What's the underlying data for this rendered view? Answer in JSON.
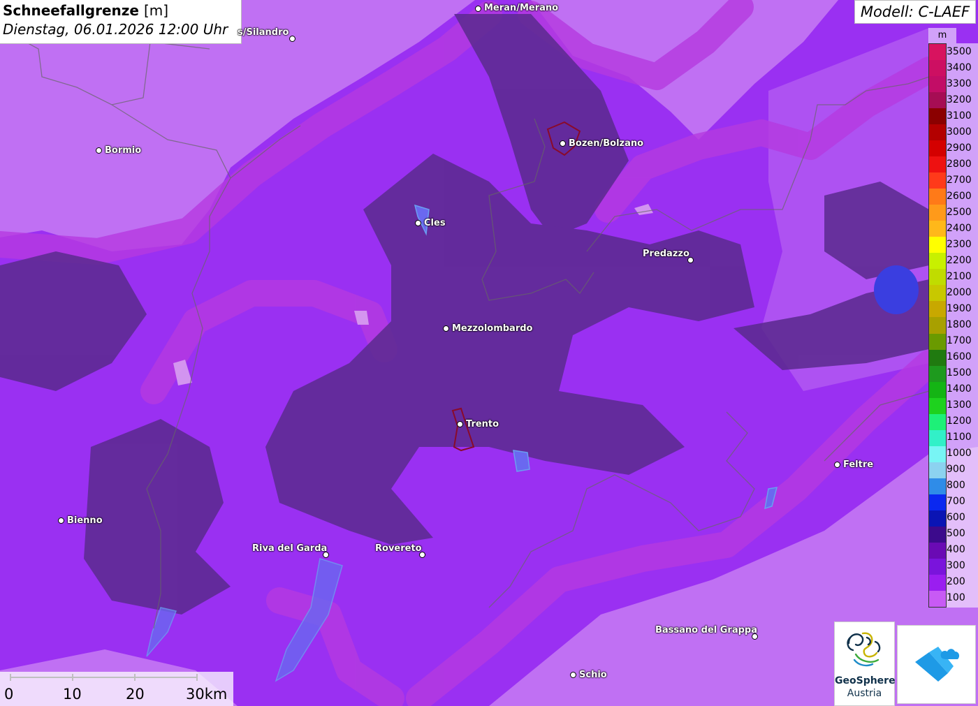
{
  "title": {
    "main": "Schneefallgrenze",
    "unit": "[m]",
    "datetime": "Dienstag, 06.01.2026 12:00 Uhr"
  },
  "model": "Modell: C-LAEF",
  "legend": {
    "unit": "m",
    "items": [
      {
        "label": "3500",
        "color": "#d8135f"
      },
      {
        "label": "3400",
        "color": "#cd0f62"
      },
      {
        "label": "3300",
        "color": "#c20d66"
      },
      {
        "label": "3200",
        "color": "#a60d54"
      },
      {
        "label": "3100",
        "color": "#8b0000"
      },
      {
        "label": "3000",
        "color": "#b30000"
      },
      {
        "label": "2900",
        "color": "#d40000"
      },
      {
        "label": "2800",
        "color": "#ee1111"
      },
      {
        "label": "2700",
        "color": "#ff3a1a"
      },
      {
        "label": "2600",
        "color": "#ff7a18"
      },
      {
        "label": "2500",
        "color": "#ff9a1a"
      },
      {
        "label": "2400",
        "color": "#ffb81a"
      },
      {
        "label": "2300",
        "color": "#ffff00"
      },
      {
        "label": "2200",
        "color": "#c8f000"
      },
      {
        "label": "2100",
        "color": "#c0dc00"
      },
      {
        "label": "2000",
        "color": "#c8c800"
      },
      {
        "label": "1900",
        "color": "#c8a800"
      },
      {
        "label": "1800",
        "color": "#a8a000"
      },
      {
        "label": "1700",
        "color": "#6a9a00"
      },
      {
        "label": "1600",
        "color": "#207a10"
      },
      {
        "label": "1500",
        "color": "#1e9a1e"
      },
      {
        "label": "1400",
        "color": "#14b414"
      },
      {
        "label": "1300",
        "color": "#1ed21e"
      },
      {
        "label": "1200",
        "color": "#1ef078"
      },
      {
        "label": "1100",
        "color": "#32f0c8"
      },
      {
        "label": "1000",
        "color": "#78f5f5"
      },
      {
        "label": "900",
        "color": "#8cd2f0"
      },
      {
        "label": "800",
        "color": "#2f8ce8"
      },
      {
        "label": "700",
        "color": "#0a28f0"
      },
      {
        "label": "600",
        "color": "#0a14b4"
      },
      {
        "label": "500",
        "color": "#3c0a8c"
      },
      {
        "label": "400",
        "color": "#6a0ab4"
      },
      {
        "label": "300",
        "color": "#7a14dc"
      },
      {
        "label": "200",
        "color": "#9a1ef0"
      },
      {
        "label": "100",
        "color": "#c85af5"
      }
    ]
  },
  "cities": [
    {
      "id": "meran",
      "name": "Meran/Merano"
    },
    {
      "id": "silandro",
      "name": "s/Silandro"
    },
    {
      "id": "bormio",
      "name": "Bormio"
    },
    {
      "id": "bozen",
      "name": "Bozen/Bolzano"
    },
    {
      "id": "cles",
      "name": "Cles"
    },
    {
      "id": "predazzo",
      "name": "Predazzo"
    },
    {
      "id": "mezzolombardo",
      "name": "Mezzolombardo"
    },
    {
      "id": "trento",
      "name": "Trento"
    },
    {
      "id": "feltre",
      "name": "Feltre"
    },
    {
      "id": "bienno",
      "name": "Bienno"
    },
    {
      "id": "riva",
      "name": "Riva del Garda"
    },
    {
      "id": "rovereto",
      "name": "Rovereto"
    },
    {
      "id": "bassano",
      "name": "Bassano del Grappa"
    },
    {
      "id": "schio",
      "name": "Schio"
    }
  ],
  "scalebar": {
    "labels": [
      "0",
      "10",
      "20",
      "30km"
    ]
  },
  "logos": {
    "geosphere_name": "GeoSphere",
    "geosphere_sub": "Austria"
  }
}
